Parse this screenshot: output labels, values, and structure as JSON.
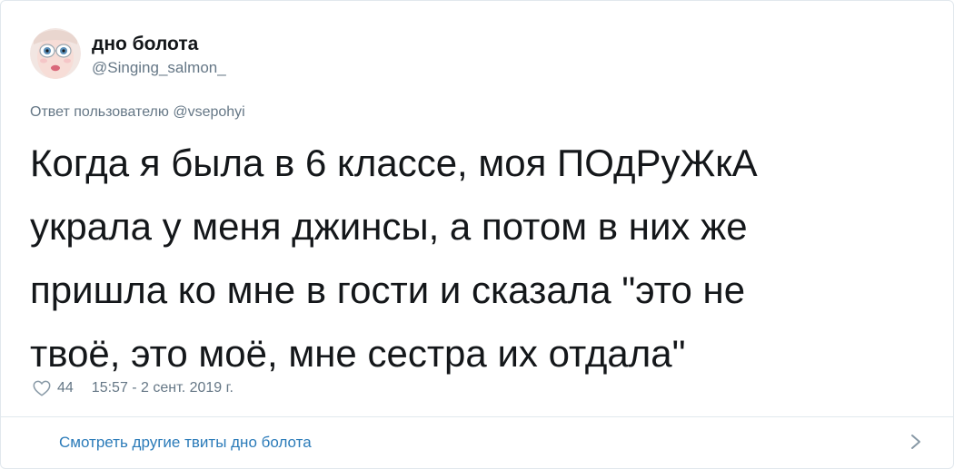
{
  "author": {
    "name": "дно болота",
    "handle": "@Singing_salmon_"
  },
  "reply": {
    "label": "Ответ пользователю",
    "user": "@vsepohyi"
  },
  "tweet": {
    "lines": [
      "Когда я была в 6 классе, моя ПОдРуЖкА",
      "украла у меня джинсы, а потом в них же",
      "пришла ко мне в гости и сказала \"это не",
      "твоё, это моё, мне сестра их отдала\""
    ],
    "likes": "44",
    "timestamp": "15:57 - 2 сент. 2019 г."
  },
  "footer": {
    "more_link": "Смотреть другие твиты дно болота"
  },
  "icons": {
    "like": "heart-icon",
    "more": "chevron-right-icon"
  },
  "colors": {
    "text": "#14171a",
    "secondary": "#657786",
    "link": "#2b7bb9",
    "border": "#e1e8ed"
  }
}
